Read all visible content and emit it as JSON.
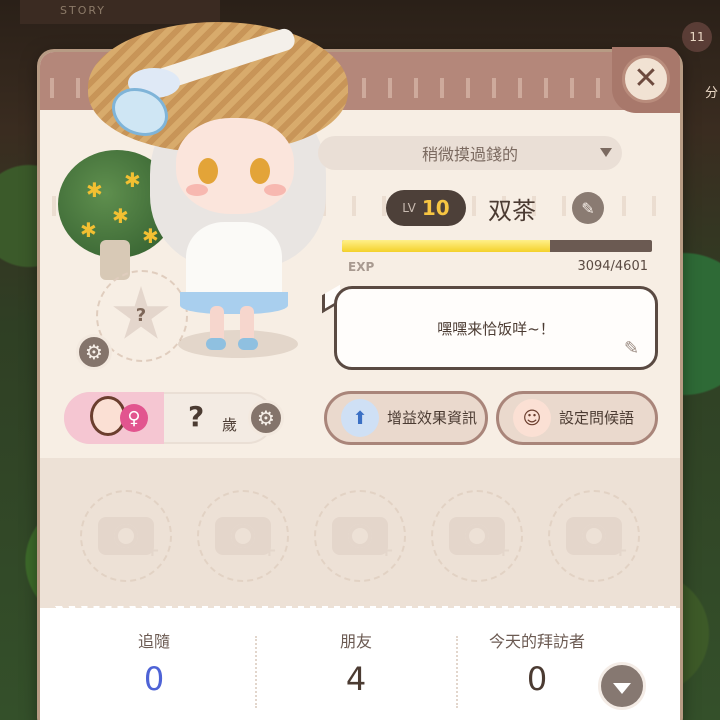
{
  "background": {
    "store_sign": "STORY",
    "notification_count": "11",
    "side_text": "分"
  },
  "profile": {
    "title_dropdown": "稍微摸過錢的",
    "level_label": "LV",
    "level": "10",
    "name": "双茶",
    "exp_label": "EXP",
    "exp_current": 3094,
    "exp_max": 4601,
    "exp_text": "3094/4601",
    "greeting": "嘿嘿来恰饭咩~！",
    "pet_placeholder": "?",
    "age_value": "?",
    "age_unit": "歲",
    "gender_badge": "♀"
  },
  "buttons": {
    "buff_info": "增益效果資訊",
    "set_greeting": "設定問候語"
  },
  "photos": {
    "slots": [
      "",
      "",
      "",
      "",
      ""
    ]
  },
  "stats": {
    "followers_label": "追隨",
    "followers_value": "0",
    "friends_label": "朋友",
    "friends_value": "4",
    "visitors_label": "今天的拜訪者",
    "visitors_value": "0"
  },
  "icons": {
    "close": "close-icon",
    "gear": "gear-icon",
    "pencil": "pencil-icon",
    "camera": "camera-icon",
    "chevron": "chevron-down-icon"
  },
  "colors": {
    "exp_fill": "#f4d12a",
    "level_text": "#f6c542",
    "followers_value": "#4e63d6",
    "female": "#e2558f"
  }
}
